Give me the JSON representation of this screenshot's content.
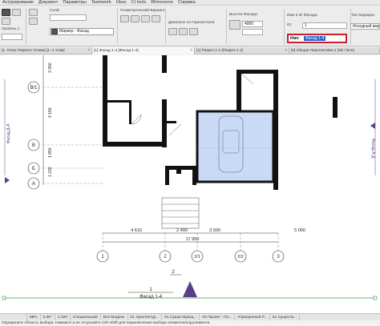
{
  "menu": [
    "Аструирование",
    "Документ",
    "Параметры",
    "Teamwork",
    "Окно",
    "CI tools",
    "Rhinoceros",
    "Справка"
  ],
  "toolbar": {
    "all_levels": "Уровень 1",
    "story_label": "Слой",
    "geom_variant_label": "Геометрический Вариант",
    "marker_label": "Маркер - Фасад",
    "range_label": "Диапазон по Горизонтали",
    "height_label": "Высота Фасада",
    "height_value": "4000",
    "name_id_label": "Имя и ID Фасада",
    "id_label": "ID:",
    "id_value": "1",
    "name_label": "Имя:",
    "name_value": "Фасад 1-4",
    "source_marker_label": "Тип Маркера",
    "source_marker_value": "Исходный маркер"
  },
  "tabs": [
    {
      "label": "[1. План Первого Этажа] [1.-1 этаж]",
      "active": false
    },
    {
      "label": "[1] Фасад 1-4 [Фасад 1-4]",
      "active": true
    },
    {
      "label": "[1] Разрез 1-1 [Разрез 1-1]",
      "active": false
    },
    {
      "label": "[0] Общая Перспектива 2 [3D / Все]",
      "active": false
    }
  ],
  "drawing": {
    "axes_left": [
      "В",
      "В/1",
      "Б",
      "А"
    ],
    "dims_vertical": [
      "3 350",
      "4 150",
      "1 850",
      "1 230"
    ],
    "dims_horizontal": [
      "4 610",
      "2 490",
      "3 500",
      "5 000"
    ],
    "dim_total": "17 950",
    "axes_bottom": [
      "1",
      "2",
      "2/1",
      "2/2",
      "3"
    ],
    "section_left": "Фасад Д-А",
    "section_right": "Фасад А-Д",
    "marker_number": "1",
    "marker_name": "Фасад 1-4",
    "label_2": "2"
  },
  "status": {
    "undo": "88%",
    "angle": "0.00°",
    "scale": "1:100",
    "layer": "Специальный",
    "model": "Вся Модель",
    "view": "01 Архитектур...",
    "mvo": "01 Существующ...",
    "project": "04 Проект - Пл...",
    "override": "Упрощенный Р...",
    "renovation": "01 Существ..."
  },
  "hint": "Определите область выбора. Нажмите и не отпускайте Ctrl+Shift для переключения выбора элемента/подэлемента.",
  "colors": {
    "highlight_box": "#c8202a",
    "selection": "#2a62c9",
    "marker": "#5a3e8c",
    "zone": "#c9daf6"
  }
}
